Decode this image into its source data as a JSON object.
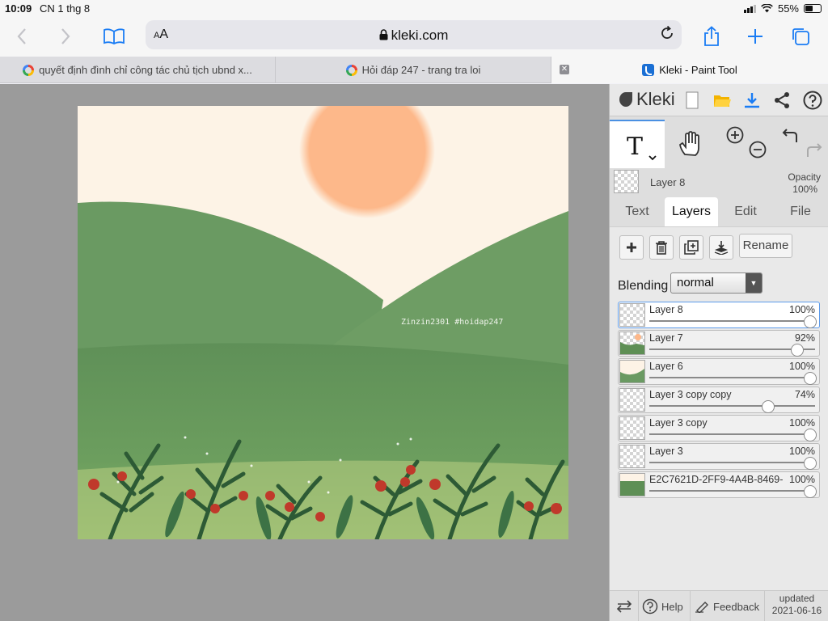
{
  "status_bar": {
    "time": "10:09",
    "date": "CN 1 thg 8",
    "battery": "55%",
    "battery_level": 0.55
  },
  "browser": {
    "url": "kleki.com",
    "text_size_label": "AA",
    "tabs": [
      {
        "title": "quyết định đình chỉ công tác chủ tịch ubnd x...",
        "icon": "google-icon",
        "active": false
      },
      {
        "title": "Hỏi đáp 247 - trang tra loi",
        "icon": "google-icon",
        "active": false
      },
      {
        "title": "Kleki - Paint Tool",
        "icon": "kleki-icon",
        "active": true
      }
    ]
  },
  "canvas": {
    "watermark": "Zinzin2301 #hoidap247",
    "colors": {
      "sky": "#fdf3e6",
      "sun": "#fdb88a",
      "hill": "#6a9a62",
      "foreground": "#5e8f55",
      "flower": "#c0392b"
    }
  },
  "panel": {
    "logo": "Kleki",
    "current_layer": {
      "name": "Layer 8",
      "opacity_label": "Opacity",
      "opacity": "100%"
    },
    "tabs": [
      "Text",
      "Layers",
      "Edit",
      "File"
    ],
    "active_tab": "Layers",
    "rename_label": "Rename",
    "blending_label": "Blending",
    "blending_value": "normal",
    "layers": [
      {
        "name": "Layer 8",
        "opacity": "100%",
        "value": 1.0,
        "selected": true
      },
      {
        "name": "Layer 7",
        "opacity": "92%",
        "value": 0.92,
        "selected": false
      },
      {
        "name": "Layer 6",
        "opacity": "100%",
        "value": 1.0,
        "selected": false
      },
      {
        "name": "Layer 3 copy copy",
        "opacity": "74%",
        "value": 0.74,
        "selected": false
      },
      {
        "name": "Layer 3 copy",
        "opacity": "100%",
        "value": 1.0,
        "selected": false
      },
      {
        "name": "Layer 3",
        "opacity": "100%",
        "value": 1.0,
        "selected": false
      },
      {
        "name": "E2C7621D-2FF9-4A4B-8469-",
        "opacity": "100%",
        "value": 1.0,
        "selected": false
      }
    ],
    "footer": {
      "help": "Help",
      "feedback": "Feedback",
      "updated_label": "updated",
      "updated_date": "2021-06-16"
    },
    "accent": "#1a7cf4"
  }
}
